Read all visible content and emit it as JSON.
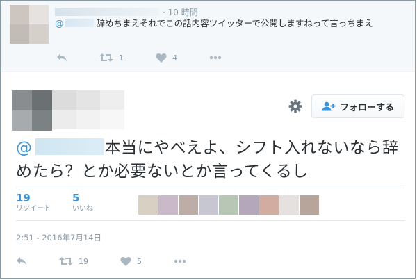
{
  "reply_tweet": {
    "timestamp": "· 10 時間",
    "mention_prefix": "@",
    "text": "辞めちまえそれでこの話内容ツイッターで公開しますねって言っちまえ",
    "retweet_count": "1",
    "like_count": "4"
  },
  "main_tweet": {
    "follow_label": "フォローする",
    "mention_prefix": "@",
    "text": "本当にやべえよ、シフト入れないなら辞めたら？とか必要ないとか言ってくるし",
    "retweets": {
      "count": "19",
      "label": "リツイート"
    },
    "likes": {
      "count": "5",
      "label": "いいね"
    },
    "liker_colors": [
      "#d8d1c3",
      "#c9b9c9",
      "#bcaea7",
      "#c7c7d1",
      "#b8c7b5",
      "#b3a8bb",
      "#d1ada1",
      "#e4e1de",
      "#b7a59c"
    ],
    "datetime": "2:51 - 2016年7月14日",
    "action_retweet_count": "19",
    "action_like_count": "5"
  },
  "colors": {
    "accent": "#3b94d9",
    "muted": "#8899a6",
    "text": "#292f33",
    "border": "#e1e8ed"
  },
  "icons": [
    "reply-icon",
    "retweet-icon",
    "like-icon",
    "more-icon",
    "gear-icon",
    "follow-person-icon"
  ]
}
